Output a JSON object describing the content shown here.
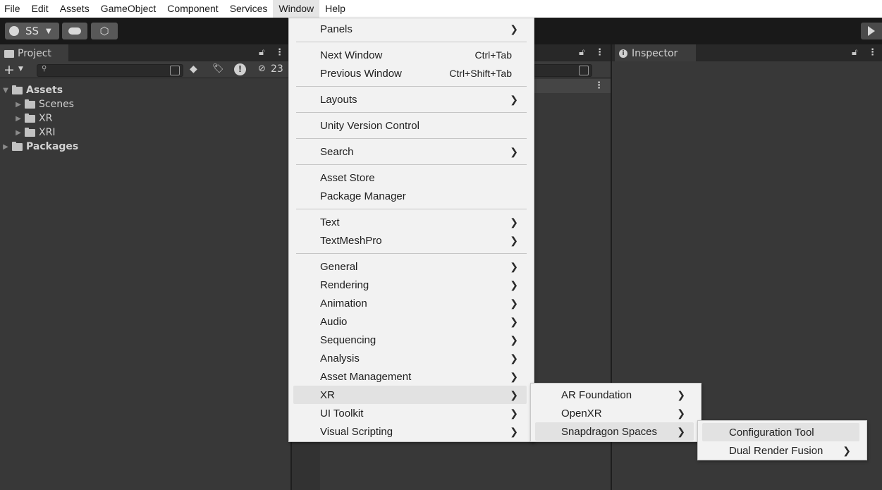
{
  "menubar": [
    "File",
    "Edit",
    "Assets",
    "GameObject",
    "Component",
    "Services",
    "Window",
    "Help"
  ],
  "toolbar": {
    "account": "SS"
  },
  "project_panel": {
    "tab": "Project",
    "hidden_count": "23",
    "tree": [
      {
        "label": "Assets"
      },
      {
        "label": "Scenes"
      },
      {
        "label": "XR"
      },
      {
        "label": "XRI"
      },
      {
        "label": "Packages"
      }
    ]
  },
  "inspector": {
    "tab": "Inspector"
  },
  "window_menu": {
    "items": [
      {
        "label": "Panels",
        "submenu": true
      },
      {
        "label": "Next Window",
        "shortcut": "Ctrl+Tab"
      },
      {
        "label": "Previous Window",
        "shortcut": "Ctrl+Shift+Tab"
      },
      {
        "label": "Layouts",
        "submenu": true
      },
      {
        "label": "Unity Version Control"
      },
      {
        "label": "Search",
        "submenu": true
      },
      {
        "label": "Asset Store"
      },
      {
        "label": "Package Manager"
      },
      {
        "label": "Text",
        "submenu": true
      },
      {
        "label": "TextMeshPro",
        "submenu": true
      },
      {
        "label": "General",
        "submenu": true
      },
      {
        "label": "Rendering",
        "submenu": true
      },
      {
        "label": "Animation",
        "submenu": true
      },
      {
        "label": "Audio",
        "submenu": true
      },
      {
        "label": "Sequencing",
        "submenu": true
      },
      {
        "label": "Analysis",
        "submenu": true
      },
      {
        "label": "Asset Management",
        "submenu": true
      },
      {
        "label": "XR",
        "submenu": true,
        "highlighted": true
      },
      {
        "label": "UI Toolkit",
        "submenu": true
      },
      {
        "label": "Visual Scripting",
        "submenu": true
      }
    ]
  },
  "xr_menu": {
    "items": [
      {
        "label": "AR Foundation",
        "submenu": true
      },
      {
        "label": "OpenXR",
        "submenu": true
      },
      {
        "label": "Snapdragon Spaces",
        "submenu": true,
        "highlighted": true
      }
    ]
  },
  "snapdragon_menu": {
    "items": [
      {
        "label": "Configuration Tool",
        "highlighted": true
      },
      {
        "label": "Dual Render Fusion",
        "submenu": true
      }
    ]
  }
}
